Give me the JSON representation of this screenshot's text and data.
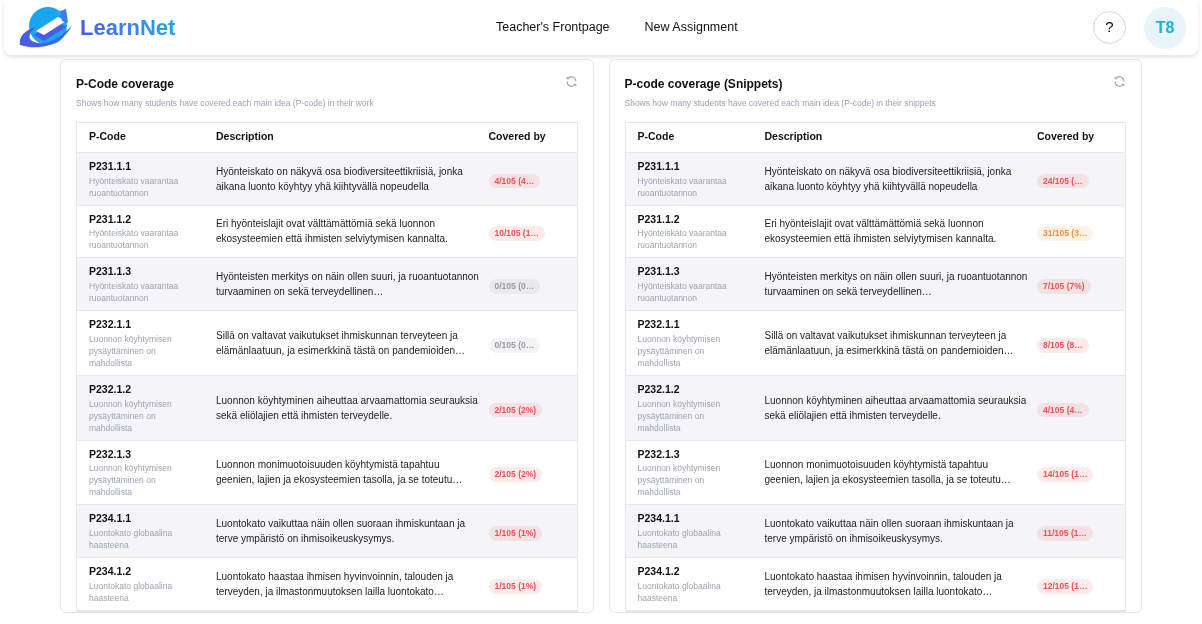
{
  "header": {
    "logo": "LearnNet",
    "nav": [
      "Teacher's Frontpage",
      "New Assignment"
    ],
    "help": "?",
    "avatar": "T8"
  },
  "panels": [
    {
      "title": "P-Code coverage",
      "subtitle": "Shows how many students have covered each main idea (P-code) in their work",
      "columns": [
        "P-Code",
        "Description",
        "Covered by"
      ],
      "rows": [
        {
          "code": "P231.1.1",
          "topic": "Hyönteiskato vaarantaa ruoantuotannon",
          "description": "Hyönteiskato on näkyvä osa biodiversiteettikriisiä, jonka aikana luonto köyhtyy yhä kiihtyvällä nopeudella",
          "covered": "4/105 (4…",
          "color": "#f05252"
        },
        {
          "code": "P231.1.2",
          "topic": "Hyönteiskato vaarantaa ruoantuotannon",
          "description": "Eri hyönteislajit ovat välttämättömiä sekä luonnon ekosysteemien että ihmisten selviytymisen kannalta.",
          "covered": "10/105 (1…",
          "color": "#f05252"
        },
        {
          "code": "P231.1.3",
          "topic": "Hyönteiskato vaarantaa ruoantuotannon",
          "description": "Hyönteisten merkitys on näin ollen suuri, ja ruoantuotannon turvaaminen on sekä terveydellinen…",
          "covered": "0/105 (0…",
          "color": "#9a9aa2"
        },
        {
          "code": "P232.1.1",
          "topic": "Luonnon köyhtymisen pysäyttäminen on mahdollista",
          "description": "Sillä on valtavat vaikutukset ihmiskunnan terveyteen ja elämänlaatuun, ja esimerkkinä tästä on pandemioiden…",
          "covered": "0/105 (0…",
          "color": "#9a9aa2"
        },
        {
          "code": "P232.1.2",
          "topic": "Luonnon köyhtymisen pysäyttäminen on mahdollista",
          "description": "Luonnon köyhtyminen aiheuttaa arvaamattomia seurauksia sekä eliölajien että ihmisten terveydelle.",
          "covered": "2/105 (2%)",
          "color": "#f05252"
        },
        {
          "code": "P232.1.3",
          "topic": "Luonnon köyhtymisen pysäyttäminen on mahdollista",
          "description": "Luonnon monimuotoisuuden köyhtymistä tapahtuu geenien, lajien ja ekosysteemien tasolla, ja se toteutu…",
          "covered": "2/105 (2%)",
          "color": "#f05252"
        },
        {
          "code": "P234.1.1",
          "topic": "Luontokato globaalina haasteena",
          "description": "Luontokato vaikuttaa näin ollen suoraan ihmiskuntaan ja terve ympäristö on ihmisoikeuskysymys.",
          "covered": "1/105 (1%)",
          "color": "#f05252"
        },
        {
          "code": "P234.1.2",
          "topic": "Luontokato globaalina haasteena",
          "description": "Luontokato haastaa ihmisen hyvinvoinnin, talouden ja terveyden, ja ilmastonmuutoksen lailla luontokato…",
          "covered": "1/105 (1%)",
          "color": "#f05252"
        }
      ]
    },
    {
      "title": "P-code coverage (Snippets)",
      "subtitle": "Shows how many students have covered each main idea (P-code) in their snippets",
      "columns": [
        "P-Code",
        "Description",
        "Covered by"
      ],
      "rows": [
        {
          "code": "P231.1.1",
          "topic": "Hyönteiskato vaarantaa ruoantuotannon",
          "description": "Hyönteiskato on näkyvä osa biodiversiteettikriisiä, jonka aikana luonto köyhtyy yhä kiihtyvällä nopeudella",
          "covered": "24/105 (…",
          "color": "#f05252"
        },
        {
          "code": "P231.1.2",
          "topic": "Hyönteiskato vaarantaa ruoantuotannon",
          "description": "Eri hyönteislajit ovat välttämättömiä sekä luonnon ekosysteemien että ihmisten selviytymisen kannalta.",
          "covered": "31/105 (3…",
          "color": "#f5922e"
        },
        {
          "code": "P231.1.3",
          "topic": "Hyönteiskato vaarantaa ruoantuotannon",
          "description": "Hyönteisten merkitys on näin ollen suuri, ja ruoantuotannon turvaaminen on sekä terveydellinen…",
          "covered": "7/105 (7%)",
          "color": "#f05252"
        },
        {
          "code": "P232.1.1",
          "topic": "Luonnon köyhtymisen pysäyttäminen on mahdollista",
          "description": "Sillä on valtavat vaikutukset ihmiskunnan terveyteen ja elämänlaatuun, ja esimerkkinä tästä on pandemioiden…",
          "covered": "8/105 (8…",
          "color": "#f05252"
        },
        {
          "code": "P232.1.2",
          "topic": "Luonnon köyhtymisen pysäyttäminen on mahdollista",
          "description": "Luonnon köyhtyminen aiheuttaa arvaamattomia seurauksia sekä eliölajien että ihmisten terveydelle.",
          "covered": "4/105 (4…",
          "color": "#f05252"
        },
        {
          "code": "P232.1.3",
          "topic": "Luonnon köyhtymisen pysäyttäminen on mahdollista",
          "description": "Luonnon monimuotoisuuden köyhtymistä tapahtuu geenien, lajien ja ekosysteemien tasolla, ja se toteutu…",
          "covered": "14/105 (1…",
          "color": "#f05252"
        },
        {
          "code": "P234.1.1",
          "topic": "Luontokato globaalina haasteena",
          "description": "Luontokato vaikuttaa näin ollen suoraan ihmiskuntaan ja terve ympäristö on ihmisoikeuskysymys.",
          "covered": "11/105 (1…",
          "color": "#f05252"
        },
        {
          "code": "P234.1.2",
          "topic": "Luontokato globaalina haasteena",
          "description": "Luontokato haastaa ihmisen hyvinvoinnin, talouden ja terveyden, ja ilmastonmuutoksen lailla luontokato…",
          "covered": "12/105 (1…",
          "color": "#f05252"
        }
      ]
    }
  ]
}
